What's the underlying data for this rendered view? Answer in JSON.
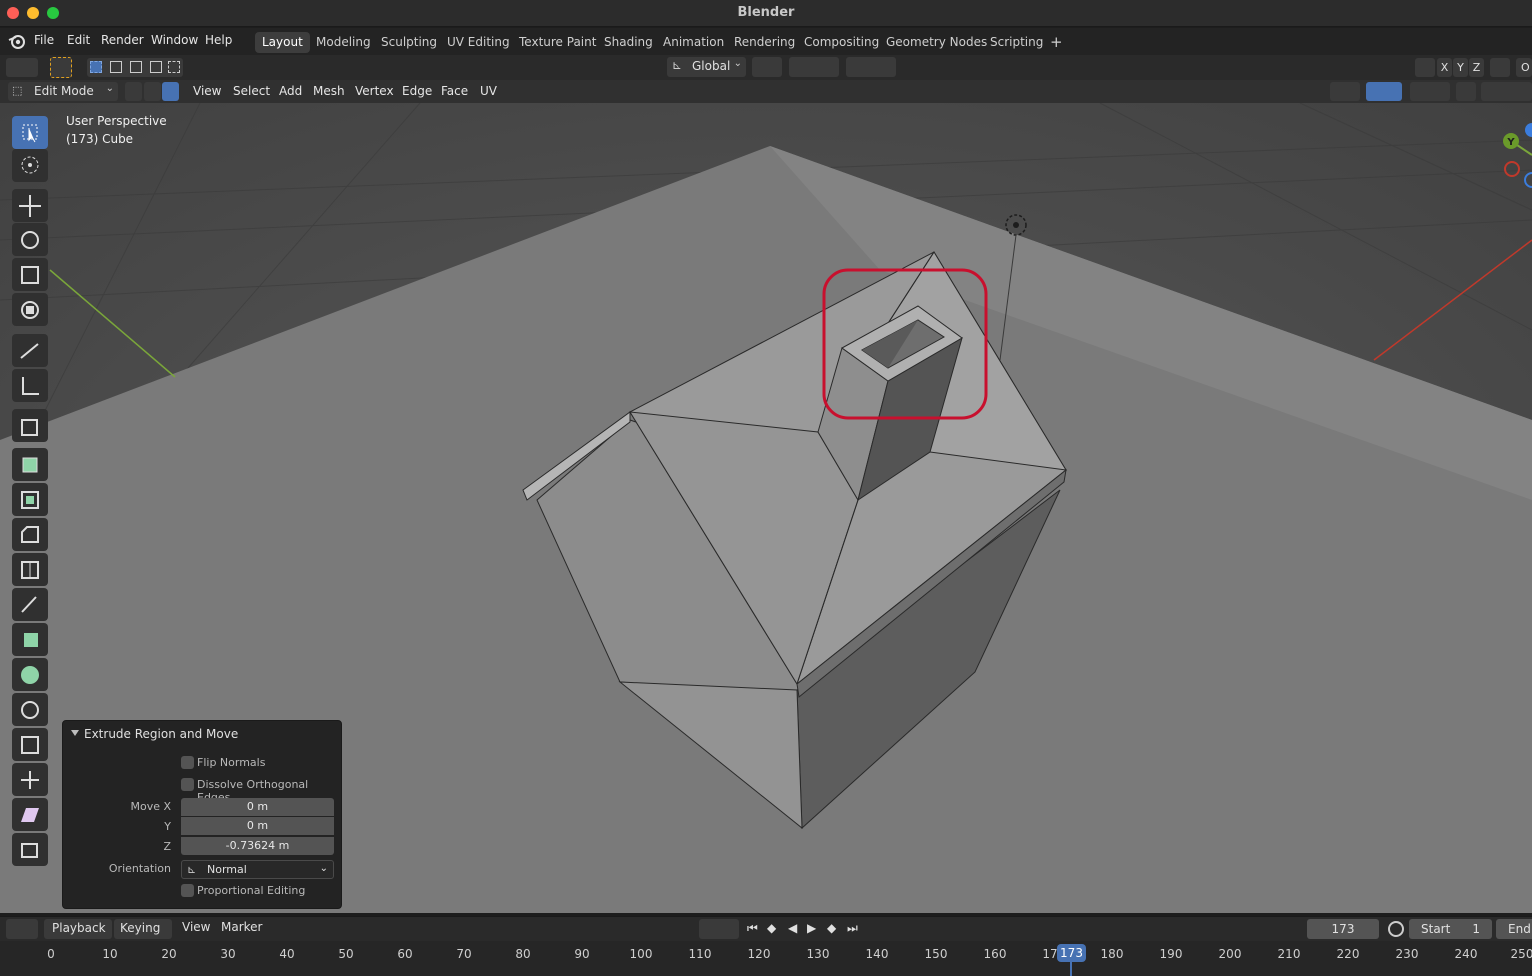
{
  "window": {
    "title": "Blender"
  },
  "menubar": {
    "items": [
      "File",
      "Edit",
      "Render",
      "Window",
      "Help"
    ]
  },
  "workspaces": {
    "tabs": [
      "Layout",
      "Modeling",
      "Sculpting",
      "UV Editing",
      "Texture Paint",
      "Shading",
      "Animation",
      "Rendering",
      "Compositing",
      "Geometry Nodes",
      "Scripting"
    ],
    "active": "Layout",
    "add_label": "+"
  },
  "tool_settings": {
    "orientation": "Global",
    "axes": [
      "X",
      "Y",
      "Z"
    ],
    "options_label": "O"
  },
  "viewport_header": {
    "mode": "Edit Mode",
    "menus": [
      "View",
      "Select",
      "Add",
      "Mesh",
      "Vertex",
      "Edge",
      "Face",
      "UV"
    ]
  },
  "viewport": {
    "perspective": "User Perspective",
    "object": "(173) Cube",
    "gizmo_y": "Y",
    "highlight_color": "#c8102e"
  },
  "operator_panel": {
    "title": "Extrude Region and Move",
    "flip_normals": "Flip Normals",
    "dissolve": "Dissolve Orthogonal Edges",
    "move_label": "Move X",
    "y_label": "Y",
    "z_label": "Z",
    "move_x": "0 m",
    "move_y": "0 m",
    "move_z": "-0.73624 m",
    "orientation_label": "Orientation",
    "orientation": "Normal",
    "proportional": "Proportional Editing"
  },
  "timeline": {
    "menus": [
      "Playback",
      "Keying",
      "View",
      "Marker"
    ],
    "current_frame": "173",
    "start_label": "Start",
    "start": "1",
    "end_label": "End",
    "ticks": [
      "0",
      "10",
      "20",
      "30",
      "40",
      "50",
      "60",
      "70",
      "80",
      "90",
      "100",
      "110",
      "120",
      "130",
      "140",
      "150",
      "160",
      "17",
      "180",
      "190",
      "200",
      "210",
      "220",
      "230",
      "240",
      "250"
    ],
    "playhead": "173"
  }
}
